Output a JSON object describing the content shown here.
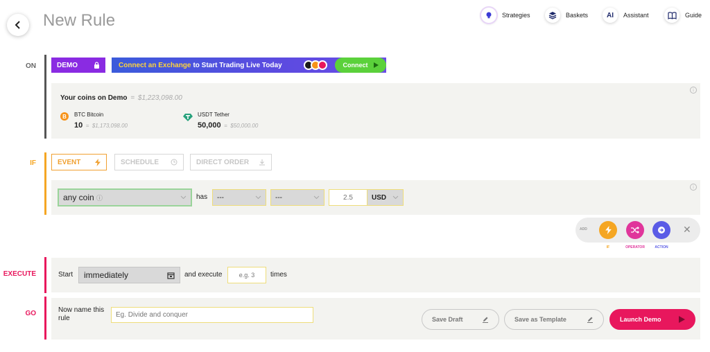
{
  "header": {
    "title": "New Rule",
    "nav": [
      {
        "label": "Strategies",
        "icon": "lightbulb-icon"
      },
      {
        "label": "Baskets",
        "icon": "layers-icon"
      },
      {
        "label": "Assistant",
        "icon": "ai-icon",
        "icon_text": "AI"
      },
      {
        "label": "Guide",
        "icon": "book-icon"
      }
    ]
  },
  "on": {
    "label": "ON",
    "demo_label": "DEMO",
    "banner": {
      "highlight": "Connect an Exchange",
      "text": "to Start Trading Live Today",
      "connect_label": "Connect"
    },
    "coins_title": "Your coins on Demo",
    "coins_eq": "=",
    "coins_total": "$1,223,098.00",
    "coins": [
      {
        "name": "BTC Bitcoin",
        "amount": "10",
        "eq": "=",
        "value": "$1,173,098.00",
        "icon": "bitcoin-icon"
      },
      {
        "name": "USDT Tether",
        "amount": "50,000",
        "eq": "=",
        "value": "$50,000.00",
        "icon": "tether-icon"
      }
    ]
  },
  "if": {
    "label": "IF",
    "tabs": [
      {
        "label": "EVENT",
        "icon": "lightning-icon"
      },
      {
        "label": "SCHEDULE",
        "icon": "clock-icon"
      },
      {
        "label": "DIRECT ORDER",
        "icon": "download-icon"
      }
    ],
    "coin_select": "any coin",
    "has_label": "has",
    "select2": "---",
    "select3": "---",
    "amount_placeholder": "2.5",
    "currency": "USD",
    "add_label": "ADD",
    "add_buttons": [
      {
        "label": "IF",
        "color": "#f5a623"
      },
      {
        "label": "OPERATOR",
        "color": "#e0359b"
      },
      {
        "label": "ACTION",
        "color": "#5a5be6"
      }
    ]
  },
  "execute": {
    "label": "EXECUTE",
    "start_label": "Start",
    "start_value": "immediately",
    "and_execute": "and execute",
    "times_placeholder": "e.g. 3",
    "times_label": "times"
  },
  "go": {
    "label": "GO",
    "name_label": "Now name this rule",
    "name_placeholder": "Eg. Divide and conquer",
    "save_draft": "Save Draft",
    "save_template": "Save as Template",
    "launch": "Launch Demo"
  },
  "colors": {
    "on": "#555555",
    "if": "#f5a623",
    "execute": "#e8175d",
    "go": "#e8175d",
    "demo": "#8a2be2",
    "connect": "#5bd13b",
    "launch": "#e8175d"
  }
}
